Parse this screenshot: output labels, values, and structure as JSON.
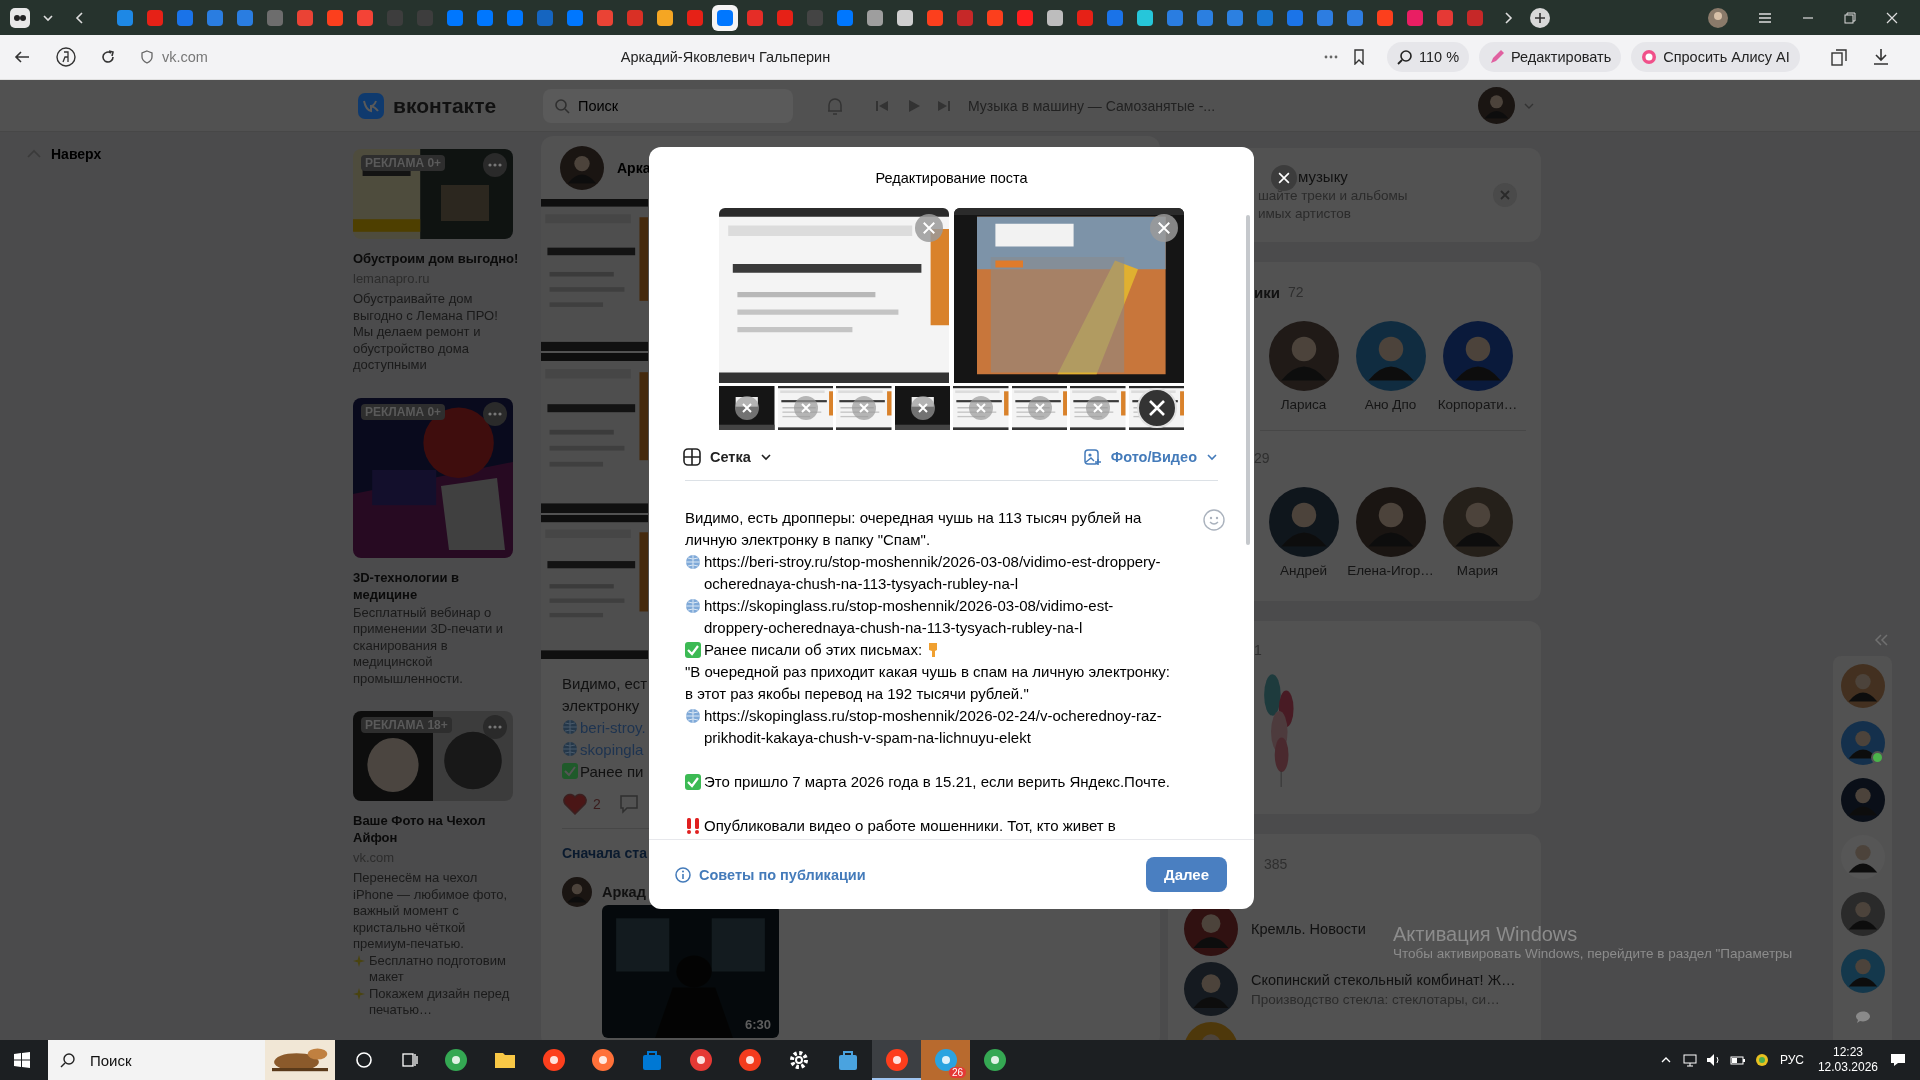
{
  "browser": {
    "tabs": [
      {
        "color": "#1e88e5",
        "selected": false
      },
      {
        "color": "#e62117",
        "selected": false
      },
      {
        "color": "#1a73e8",
        "selected": false
      },
      {
        "color": "#2a7de1",
        "selected": false
      },
      {
        "color": "#2a7de1",
        "selected": false
      },
      {
        "color": "#6d6d6d",
        "selected": false
      },
      {
        "color": "#ea4335",
        "selected": false
      },
      {
        "color": "#fc3f1d",
        "selected": false
      },
      {
        "color": "#f44336",
        "selected": false
      },
      {
        "color": "#3d3d3d",
        "selected": false
      },
      {
        "color": "#3d3d3d",
        "selected": false
      },
      {
        "color": "#0077ff",
        "selected": false
      },
      {
        "color": "#0077ff",
        "selected": false
      },
      {
        "color": "#0077ff",
        "selected": false
      },
      {
        "color": "#1565c0",
        "selected": false
      },
      {
        "color": "#0077ff",
        "selected": false
      },
      {
        "color": "#ea4335",
        "selected": false
      },
      {
        "color": "#d93025",
        "selected": false
      },
      {
        "color": "#f5a623",
        "selected": false
      },
      {
        "color": "#e62117",
        "selected": false
      },
      {
        "color": "#0077ff",
        "selected": true
      },
      {
        "color": "#e52d27",
        "selected": false
      },
      {
        "color": "#e62117",
        "selected": false
      },
      {
        "color": "#444444",
        "selected": false
      },
      {
        "color": "#0077ff",
        "selected": false
      },
      {
        "color": "#9e9e9e",
        "selected": false
      },
      {
        "color": "#cfcfcf",
        "selected": false
      },
      {
        "color": "#fc3f1d",
        "selected": false
      },
      {
        "color": "#c62828",
        "selected": false
      },
      {
        "color": "#fc3f1d",
        "selected": false
      },
      {
        "color": "#ff1f1f",
        "selected": false
      },
      {
        "color": "#bdbdbd",
        "selected": false
      },
      {
        "color": "#e62117",
        "selected": false
      },
      {
        "color": "#1a73e8",
        "selected": false
      },
      {
        "color": "#26c6da",
        "selected": false
      },
      {
        "color": "#2a7de1",
        "selected": false
      },
      {
        "color": "#2b7fe0",
        "selected": false
      },
      {
        "color": "#2c80e1",
        "selected": false
      },
      {
        "color": "#1976d2",
        "selected": false
      },
      {
        "color": "#1b74e8",
        "selected": false
      },
      {
        "color": "#2d7de1",
        "selected": false
      },
      {
        "color": "#2e7de1",
        "selected": false
      },
      {
        "color": "#fc3f1d",
        "selected": false
      },
      {
        "color": "#e91e63",
        "selected": false
      },
      {
        "color": "#e53935",
        "selected": false
      },
      {
        "color": "#c62828",
        "selected": false
      }
    ],
    "url": "vk.com",
    "page_title": "Аркадий-Яковлевич Гальперин",
    "zoom": "110 %",
    "edit_button": "Редактировать",
    "alice_button": "Спросить Алису AI"
  },
  "vk_header": {
    "logo": "вконтакте",
    "search_placeholder": "Поиск",
    "track": "Музыка в машину — Самозанятые -..."
  },
  "back_to_top": "Наверх",
  "ads": [
    {
      "kind": "wide",
      "badge": "РЕКЛАМА 0+",
      "title": "Обустроим дом выгодно!",
      "domain": "lemanapro.ru",
      "description": [
        "Обустраивайте дом выгодно с Лемана ПРО! Мы делаем ремонт и обустройство дома доступными"
      ]
    },
    {
      "kind": "square",
      "badge": "РЕКЛАМА 0+",
      "title": "3D-технологии в медицине",
      "description": [
        "Бесплатный вебинар о применении 3D-печати и сканирования в медицинской промышленности."
      ]
    },
    {
      "kind": "wide",
      "badge": "РЕКЛАМА 18+",
      "title": "Ваше Фото на Чехол Айфон",
      "domain": "vk.com",
      "description": [
        "Перенесём на чехол iPhone — любимое фото, важный момент с кристально чёткой премиум-печатью.",
        "Бесплатно подготовим макет",
        "Покажем дизайн перед печатью…"
      ]
    }
  ],
  "feed": {
    "author": "Арка",
    "lines": [
      {
        "kind": "text",
        "text": "Видимо, ест"
      },
      {
        "kind": "text",
        "text": "электронку"
      },
      {
        "kind": "link",
        "text": "beri-stroy."
      },
      {
        "kind": "link",
        "text": "skopingla"
      },
      {
        "kind": "check",
        "text": "Ранее пи"
      }
    ],
    "likes": "2",
    "liked": true,
    "sort": "Сначала ста",
    "comment_author": "Аркад",
    "video_duration": "6:30"
  },
  "right_column": {
    "music": {
      "title": "музыку",
      "lines": [
        "шайте треки и альбомы",
        "имых артистов"
      ]
    },
    "friends": {
      "title": "ики",
      "count": "72",
      "people": [
        "Лариса",
        "Ано Дпо",
        "Корпорати…"
      ]
    },
    "people_list_2": {
      "count": "29",
      "people": [
        "Андрей",
        "Елена-Игор…",
        "Мария"
      ]
    },
    "birthdays": {
      "count": "1"
    },
    "groups": {
      "count": "385",
      "items": [
        {
          "name": "Кремль. Новости"
        },
        {
          "name": "Скопинский стекольный комбинат! Ж…",
          "subtitle": "Производство стекла: стеклотары, си…"
        }
      ]
    }
  },
  "chats": [
    {
      "online": false
    },
    {
      "online": true
    },
    {
      "online": false
    },
    {
      "online": false
    },
    {
      "online": false
    },
    {
      "online": false
    }
  ],
  "os_notice": {
    "title": "Активация Windows",
    "text": "Чтобы активировать Windows, перейдите в раздел \"Параметры"
  },
  "modal": {
    "title": "Редактирование поста",
    "attachments": [
      {
        "kind": "picture"
      },
      {
        "kind": "picture"
      }
    ],
    "thumbnails": [
      {
        "kind": "picture",
        "hovered": false
      },
      {
        "kind": "picture",
        "hovered": false
      },
      {
        "kind": "picture",
        "hovered": false
      },
      {
        "kind": "picture",
        "hovered": false
      },
      {
        "kind": "picture",
        "hovered": false
      },
      {
        "kind": "picture",
        "hovered": false
      },
      {
        "kind": "picture",
        "hovered": false
      },
      {
        "kind": "picture",
        "hovered": true
      }
    ],
    "layout_label": "Сетка",
    "media_label": "Фото/Видео",
    "body": [
      {
        "kind": "text",
        "text": "Видимо, есть дропперы: очередная чушь на 113 тысяч рублей на личную электронку в папку \"Спам\"."
      },
      {
        "kind": "link",
        "text": "https://beri-stroy.ru/stop-moshennik/2026-03-08/vidimo-est-droppery-ocherednaya-chush-na-113-tysyach-rubley-na-l"
      },
      {
        "kind": "link",
        "text": "https://skopinglass.ru/stop-moshennik/2026-03-08/vidimo-est-droppery-ocherednaya-chush-na-113-tysyach-rubley-na-l"
      },
      {
        "kind": "check",
        "text": "Ранее писали об этих письмах:",
        "pointing": true
      },
      {
        "kind": "text",
        "text": "\"В очередной раз приходит какая чушь в спам на личную электронку: в этот раз якобы перевод на 192 тысячи рублей.\""
      },
      {
        "kind": "link",
        "text": "https://skopinglass.ru/stop-moshennik/2026-02-24/v-ocherednoy-raz-prikhodit-kakaya-chush-v-spam-na-lichnuyu-elekt"
      },
      {
        "kind": "blank"
      },
      {
        "kind": "check",
        "text": "Это пришло 7 марта 2026 года в 15.21, если верить Яндекс.Почте.",
        "pointing": false
      },
      {
        "kind": "blank"
      },
      {
        "kind": "alert",
        "text": "Опубликовали видео о работе мошенники. Тот, кто живет в"
      }
    ],
    "tips_link": "Советы по публикации",
    "next_button": "Далее"
  },
  "taskbar": {
    "search_placeholder": "Поиск",
    "apps": [
      {
        "kind": "app",
        "color": "#34a853",
        "selected": false
      },
      {
        "kind": "folder",
        "color": "#f9c846",
        "selected": false
      },
      {
        "kind": "app",
        "color": "#fc3f1d",
        "selected": false
      },
      {
        "kind": "app",
        "color": "#ff7139",
        "selected": false
      },
      {
        "kind": "store",
        "color": "#0078d4",
        "selected": false
      },
      {
        "kind": "app",
        "color": "#e53935",
        "selected": false
      },
      {
        "kind": "app",
        "color": "#f33b1d",
        "selected": false
      },
      {
        "kind": "gear",
        "color": "#ffffff",
        "selected": false
      },
      {
        "kind": "store",
        "color": "#4aa3df",
        "selected": false
      },
      {
        "kind": "app",
        "color": "#fd3e1c",
        "selected": true
      },
      {
        "kind": "app",
        "color": "#2aa3e0",
        "selected": false,
        "badge": "26",
        "attention": true
      },
      {
        "kind": "app",
        "color": "#35a853",
        "selected": false
      }
    ],
    "lang": "РУС",
    "time": "12:23",
    "date": "12.03.2026"
  }
}
